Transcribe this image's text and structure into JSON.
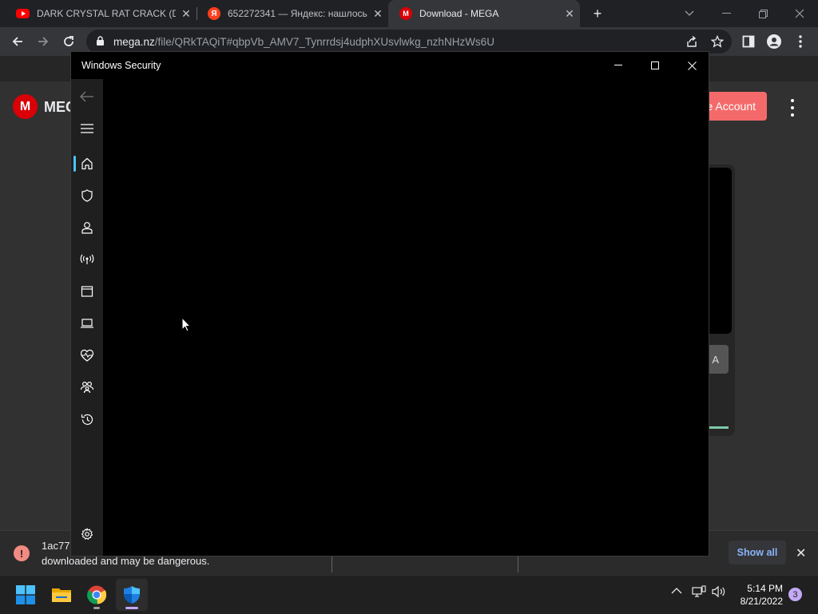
{
  "browser": {
    "tabs": [
      {
        "title": "DARK CRYSTAL RAT CRACK (DCR",
        "favicon": "youtube-icon",
        "active": false
      },
      {
        "title": "652272341 — Яндекс: нашлось",
        "favicon": "yandex-icon",
        "favicon_glyph": "Я",
        "active": false
      },
      {
        "title": "Download - MEGA",
        "favicon": "mega-icon",
        "favicon_glyph": "M",
        "active": true
      }
    ],
    "new_tab_label": "+",
    "url_host": "mega.nz",
    "url_path": "/file/QRkTAQiT#qbpVb_AMV7_Tynrrdsj4udphXUsvlwkg_nzhNHzWs6U"
  },
  "mega": {
    "logo_glyph": "M",
    "brand_partial": "MEG",
    "create_account_partial": "e Account",
    "card_button_partial": "A"
  },
  "download_bar": {
    "file_name_partial": "1ac77",
    "warning": "downloaded and may be dangerous.",
    "warning_icon_glyph": "!",
    "show_all": "Show all"
  },
  "windows_security": {
    "title": "Windows Security",
    "nav_items": [
      {
        "name": "home-icon",
        "active": true
      },
      {
        "name": "virus-protection-shield-icon",
        "active": false
      },
      {
        "name": "account-protection-icon",
        "active": false
      },
      {
        "name": "firewall-network-icon",
        "active": false
      },
      {
        "name": "app-browser-control-icon",
        "active": false
      },
      {
        "name": "device-security-icon",
        "active": false
      },
      {
        "name": "device-health-icon",
        "active": false
      },
      {
        "name": "family-options-icon",
        "active": false
      },
      {
        "name": "protection-history-icon",
        "active": false
      }
    ],
    "accent_color": "#4cc2ff"
  },
  "taskbar": {
    "apps": [
      "start-icon",
      "file-explorer-icon",
      "chrome-icon",
      "windows-security-icon"
    ],
    "time": "5:14 PM",
    "date": "8/21/2022",
    "notification_count": "3"
  }
}
